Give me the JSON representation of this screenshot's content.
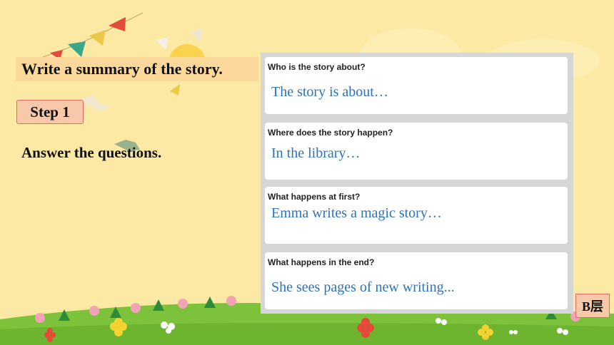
{
  "slide": {
    "title": "Write a summary of the story.",
    "step_label": "Step 1",
    "instruction": "Answer the questions.",
    "level_badge": "B层"
  },
  "questions": [
    {
      "question": "Who is the story about?",
      "answer": "The story is about…"
    },
    {
      "question": "Where does the story happen?",
      "answer": "In the library…"
    },
    {
      "question": "What happens at first?",
      "answer": "Emma writes a magic story…"
    },
    {
      "question": "What happens in the end?",
      "answer": "She sees pages of new writing..."
    }
  ],
  "colors": {
    "background": "#fce9a3",
    "grass": "#7cc23a",
    "answer_text": "#2e73b8",
    "badge_fill": "#f7c9a9",
    "badge_border": "#e06a6a"
  }
}
